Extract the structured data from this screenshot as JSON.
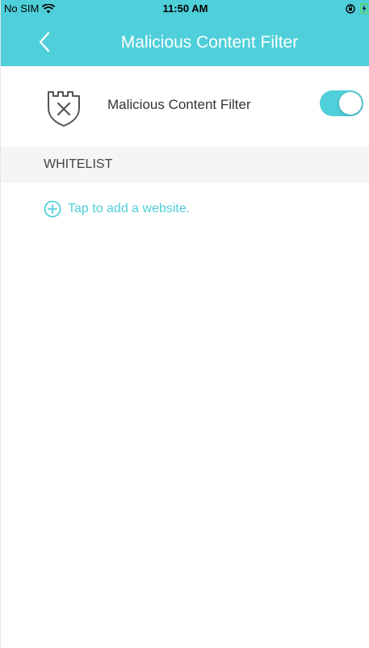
{
  "status_bar": {
    "carrier": "No SIM",
    "time": "11:50 AM",
    "wifi_icon": "wifi-icon",
    "orientation_icon": "orientation-lock-icon",
    "battery_icon": "battery-charging-icon"
  },
  "nav": {
    "title": "Malicious Content Filter",
    "back_icon": "chevron-left-icon"
  },
  "setting": {
    "icon": "shield-x-icon",
    "label": "Malicious Content Filter",
    "enabled": true
  },
  "whitelist": {
    "header": "WHITELIST",
    "add_label": "Tap to add a website.",
    "add_icon": "plus-circle-icon"
  },
  "colors": {
    "accent": "#4fcfd9",
    "section_bg": "#f5f5f5",
    "text": "#333333"
  }
}
